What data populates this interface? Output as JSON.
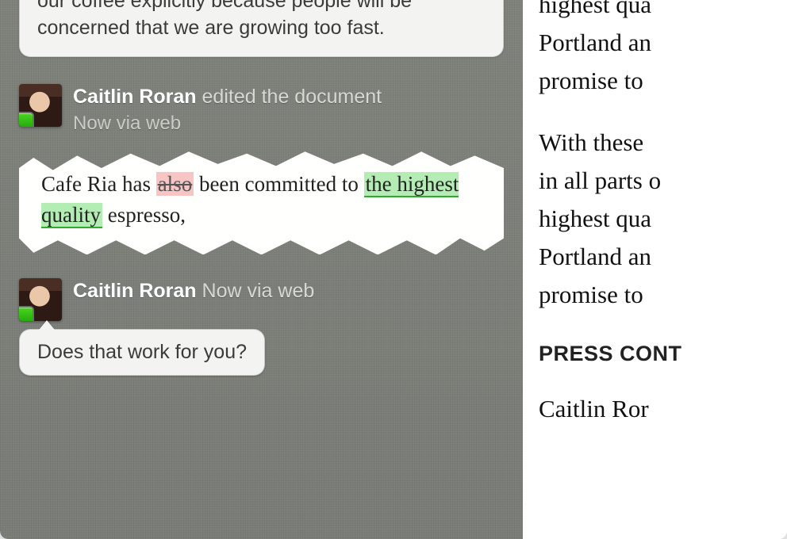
{
  "chat": {
    "top_bubble_text": "our coffee explicitly because people will be concerned that we are growing too fast.",
    "edit_event": {
      "author_name": "Caitlin Roran",
      "action_text": "edited the document",
      "meta_text": "Now via web"
    },
    "diff_snippet": {
      "prefix": "Cafe Ria has ",
      "deleted": "also",
      "mid": " been committed to ",
      "inserted": "the highest quality",
      "suffix": " espresso,"
    },
    "reply_event": {
      "author_name": "Caitlin Roran",
      "meta_text": "Now via web",
      "message": "Does that work for you?"
    }
  },
  "document": {
    "para1_lines": [
      "highest qua",
      "Portland an",
      "promise to "
    ],
    "para2_lines": [
      "With these ",
      "in all parts o",
      "highest qua",
      "Portland an",
      "promise to "
    ],
    "heading": "PRESS CONT",
    "para3_line": "Caitlin Ror"
  }
}
